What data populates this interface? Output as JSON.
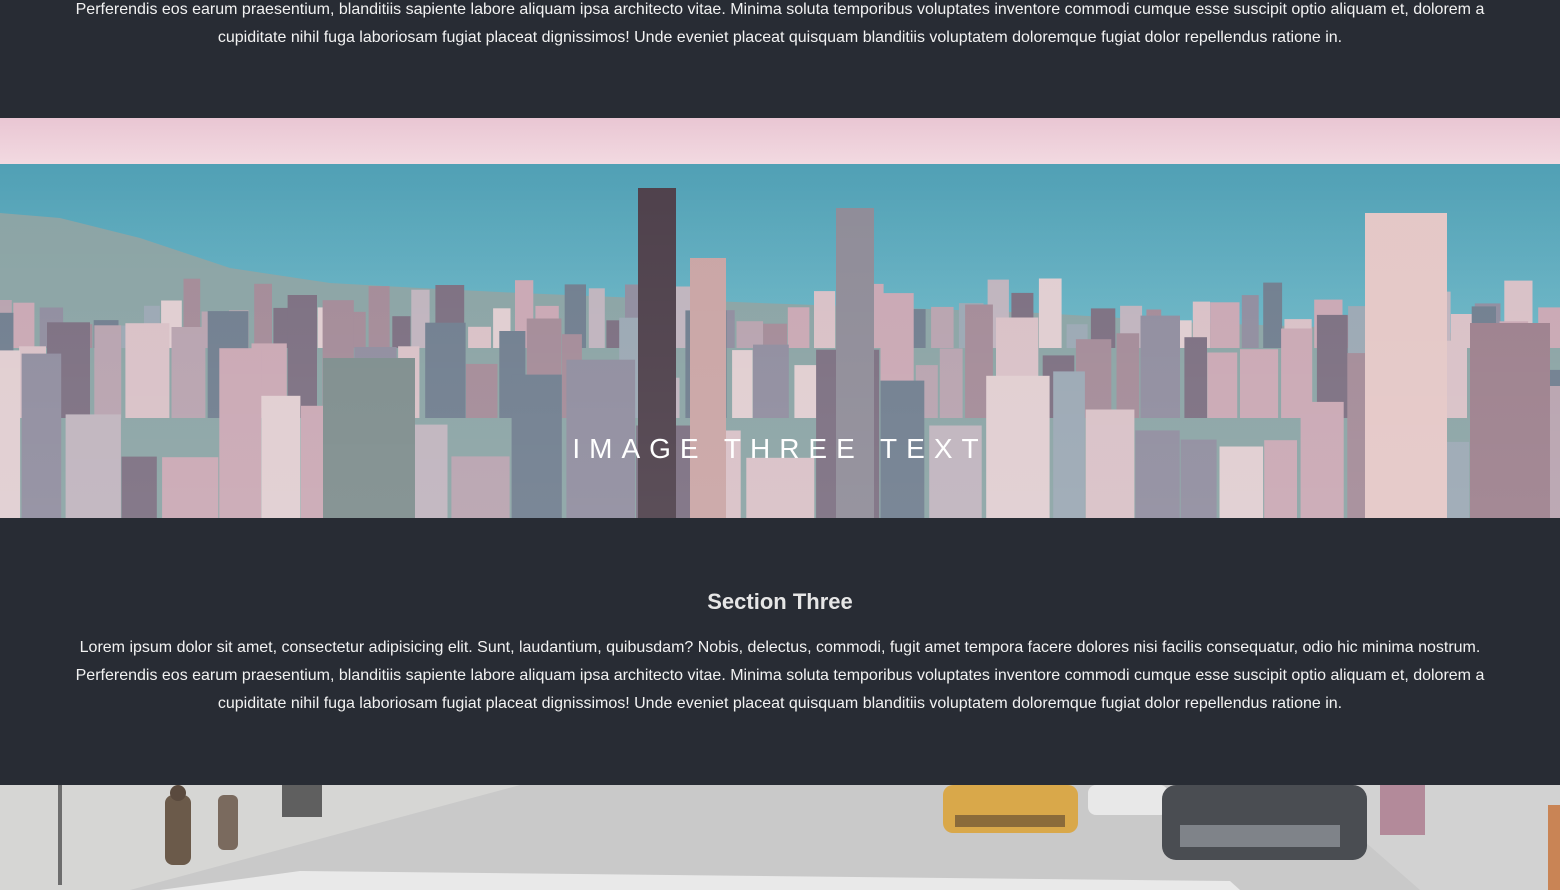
{
  "section_top": {
    "paragraph": "Perferendis eos earum praesentium, blanditiis sapiente labore aliquam ipsa architecto vitae. Minima soluta temporibus voluptates inventore commodi cumque esse suscipit optio aliquam et, dolorem a cupiditate nihil fuga laboriosam fugiat placeat dignissimos! Unde eveniet placeat quisquam blanditiis voluptatem doloremque fugiat dolor repellendus ratione in."
  },
  "image_three": {
    "caption": "IMAGE THREE TEXT"
  },
  "section_three": {
    "heading": "Section Three",
    "paragraph": "Lorem ipsum dolor sit amet, consectetur adipisicing elit. Sunt, laudantium, quibusdam? Nobis, delectus, commodi, fugit amet tempora facere dolores nisi facilis consequatur, odio hic minima nostrum. Perferendis eos earum praesentium, blanditiis sapiente labore aliquam ipsa architecto vitae. Minima soluta temporibus voluptates inventore commodi cumque esse suscipit optio aliquam et, dolorem a cupiditate nihil fuga laboriosam fugiat placeat dignissimos! Unde eveniet placeat quisquam blanditiis voluptatem doloremque fugiat dolor repellendus ratione in."
  },
  "colors": {
    "background": "#282c34",
    "text": "#f2f2f2",
    "heading": "#e6e6e6"
  }
}
